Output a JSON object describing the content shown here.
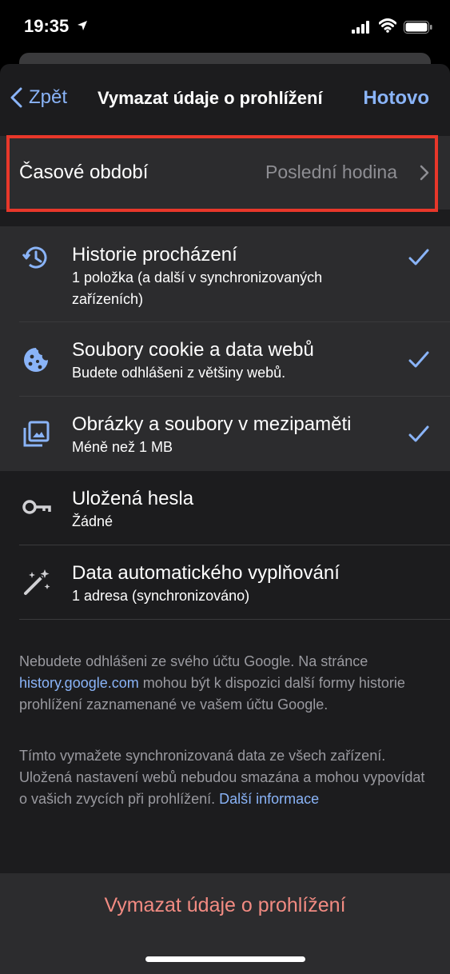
{
  "status_bar": {
    "time": "19:35"
  },
  "nav": {
    "back_label": "Zpět",
    "title": "Vymazat údaje o prohlížení",
    "done_label": "Hotovo"
  },
  "time_range": {
    "label": "Časové období",
    "value": "Poslední hodina"
  },
  "items": [
    {
      "title": "Historie procházení",
      "subtitle": "1 položka (a další v synchronizovaných zařízeních)",
      "checked": true,
      "icon": "history-icon"
    },
    {
      "title": "Soubory cookie a data webů",
      "subtitle": "Budete odhlášeni z většiny webů.",
      "checked": true,
      "icon": "cookie-icon"
    },
    {
      "title": "Obrázky a soubory v mezipaměti",
      "subtitle": "Méně než 1 MB",
      "checked": true,
      "icon": "images-icon"
    },
    {
      "title": "Uložená hesla",
      "subtitle": "Žádné",
      "checked": false,
      "icon": "key-icon"
    },
    {
      "title": "Data automatického vyplňování",
      "subtitle": "1 adresa (synchronizováno)",
      "checked": false,
      "icon": "magic-wand-icon"
    }
  ],
  "footer": {
    "p1_before": "Nebudete odhlášeni ze svého účtu Google. Na stránce ",
    "p1_link": "history.google.com",
    "p1_after": " mohou být k dispozici další formy historie prohlížení zaznamenané ve vašem účtu Google.",
    "p2_before": "Tímto vymažete synchronizovaná data ze všech zařízení. Uložená nastavení webů nebudou smazána a mohou vypovídat o vašich zvycích při prohlížení. ",
    "p2_link": "Další informace"
  },
  "clear_button": "Vymazat údaje o prohlížení",
  "colors": {
    "accent": "#8ab4f8",
    "destructive": "#f28b82",
    "highlight": "#e8372a"
  }
}
